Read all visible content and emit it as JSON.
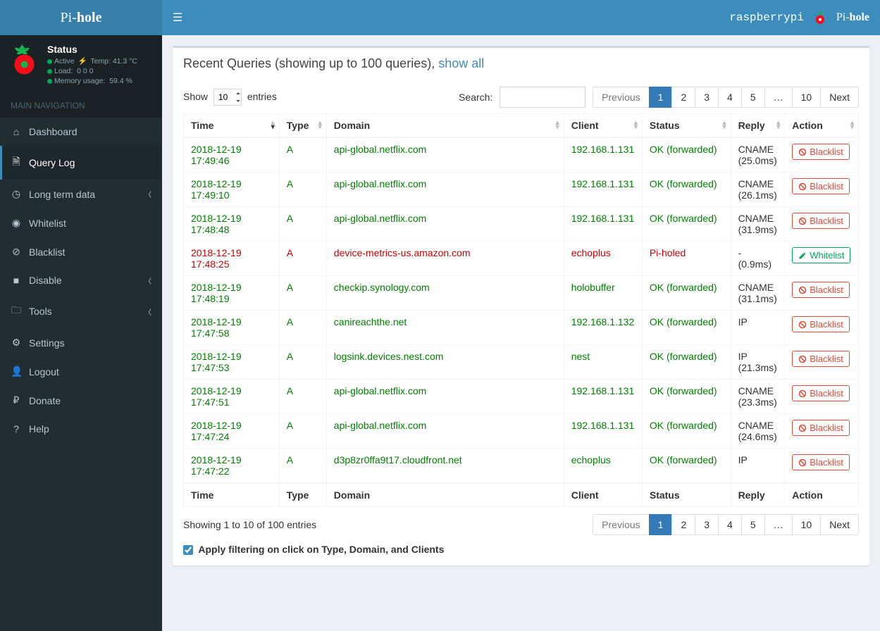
{
  "logo": {
    "pre": "Pi-",
    "bold": "hole"
  },
  "status_panel": {
    "title": "Status",
    "active": "Active",
    "temp": "Temp: 41.3 °C",
    "load_label": "Load:",
    "load": "0  0  0",
    "mem_label": "Memory usage:",
    "mem": "59.4 %"
  },
  "nav_header": "MAIN NAVIGATION",
  "nav": {
    "dashboard": "Dashboard",
    "querylog": "Query Log",
    "longterm": "Long term data",
    "whitelist": "Whitelist",
    "blacklist": "Blacklist",
    "disable": "Disable",
    "tools": "Tools",
    "settings": "Settings",
    "logout": "Logout",
    "donate": "Donate",
    "help": "Help"
  },
  "header": {
    "hostname": "raspberrypi",
    "brand_pre": "Pi-",
    "brand_bold": "hole"
  },
  "box_title_pre": "Recent Queries (showing up to 100 queries), ",
  "box_title_link": "show all",
  "dt": {
    "show": "Show",
    "entries": "entries",
    "length_value": "10",
    "search_label": "Search:",
    "info": "Showing 1 to 10 of 100 entries",
    "prev": "Previous",
    "next": "Next",
    "pages": [
      "1",
      "2",
      "3",
      "4",
      "5",
      "…",
      "10"
    ]
  },
  "cols": {
    "time": "Time",
    "type": "Type",
    "domain": "Domain",
    "client": "Client",
    "status": "Status",
    "reply": "Reply",
    "action": "Action"
  },
  "btn": {
    "blacklist": "Blacklist",
    "whitelist": "Whitelist"
  },
  "rows": [
    {
      "time": "2018-12-19 17:49:46",
      "type": "A",
      "domain": "api-global.netflix.com",
      "client": "192.168.1.131",
      "status": "OK (forwarded)",
      "reply": "CNAME (25.0ms)",
      "blocked": false
    },
    {
      "time": "2018-12-19 17:49:10",
      "type": "A",
      "domain": "api-global.netflix.com",
      "client": "192.168.1.131",
      "status": "OK (forwarded)",
      "reply": "CNAME (26.1ms)",
      "blocked": false
    },
    {
      "time": "2018-12-19 17:48:48",
      "type": "A",
      "domain": "api-global.netflix.com",
      "client": "192.168.1.131",
      "status": "OK (forwarded)",
      "reply": "CNAME (31.9ms)",
      "blocked": false
    },
    {
      "time": "2018-12-19 17:48:25",
      "type": "A",
      "domain": "device-metrics-us.amazon.com",
      "client": "echoplus",
      "status": "Pi-holed",
      "reply": "- (0.9ms)",
      "blocked": true
    },
    {
      "time": "2018-12-19 17:48:19",
      "type": "A",
      "domain": "checkip.synology.com",
      "client": "holobuffer",
      "status": "OK (forwarded)",
      "reply": "CNAME (31.1ms)",
      "blocked": false
    },
    {
      "time": "2018-12-19 17:47:58",
      "type": "A",
      "domain": "canireachthe.net",
      "client": "192.168.1.132",
      "status": "OK (forwarded)",
      "reply": "IP",
      "blocked": false
    },
    {
      "time": "2018-12-19 17:47:53",
      "type": "A",
      "domain": "logsink.devices.nest.com",
      "client": "nest",
      "status": "OK (forwarded)",
      "reply": "IP (21.3ms)",
      "blocked": false
    },
    {
      "time": "2018-12-19 17:47:51",
      "type": "A",
      "domain": "api-global.netflix.com",
      "client": "192.168.1.131",
      "status": "OK (forwarded)",
      "reply": "CNAME (23.3ms)",
      "blocked": false
    },
    {
      "time": "2018-12-19 17:47:24",
      "type": "A",
      "domain": "api-global.netflix.com",
      "client": "192.168.1.131",
      "status": "OK (forwarded)",
      "reply": "CNAME (24.6ms)",
      "blocked": false
    },
    {
      "time": "2018-12-19 17:47:22",
      "type": "A",
      "domain": "d3p8zr0ffa9t17.cloudfront.net",
      "client": "echoplus",
      "status": "OK (forwarded)",
      "reply": "IP",
      "blocked": false
    }
  ],
  "apply_filter_label": "Apply filtering on click on Type, Domain, and Clients"
}
